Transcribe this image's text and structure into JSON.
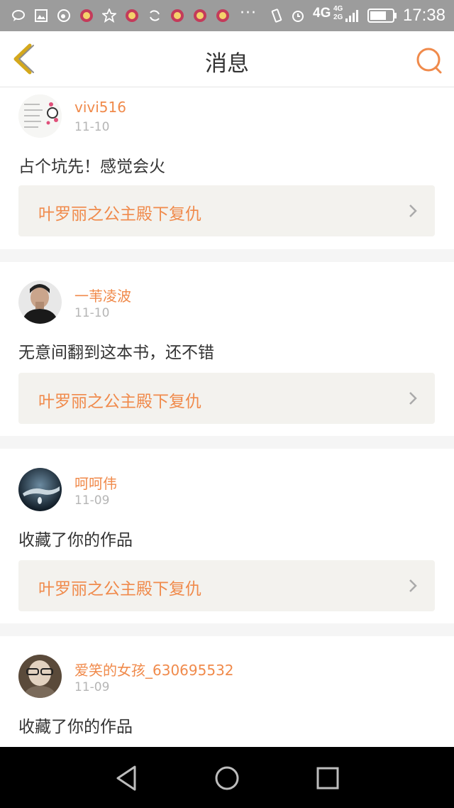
{
  "status_bar": {
    "network": "4G",
    "network_sub": [
      "4G",
      "2G"
    ],
    "time": "17:38",
    "more": "···"
  },
  "header": {
    "title": "消息",
    "back_icon": "back-chevron-icon",
    "search_icon": "search-icon"
  },
  "messages": [
    {
      "username": "vivi516",
      "date": "11-10",
      "text": "占个坑先！感觉会火",
      "book_title": "叶罗丽之公主殿下复仇"
    },
    {
      "username": "一苇凌波",
      "date": "11-10",
      "text": "无意间翻到这本书，还不错",
      "book_title": "叶罗丽之公主殿下复仇"
    },
    {
      "username": "呵呵伟",
      "date": "11-09",
      "text": "收藏了你的作品",
      "book_title": "叶罗丽之公主殿下复仇"
    },
    {
      "username": "爱笑的女孩_630695532",
      "date": "11-09",
      "text": "收藏了你的作品"
    }
  ],
  "colors": {
    "accent": "#f08a4b",
    "back_icon": "#d4a81c",
    "date": "#b5b5b5",
    "card_link_bg": "#f3f2ee"
  },
  "nav_bar": {
    "icons": [
      "back-triangle-icon",
      "home-circle-icon",
      "recents-square-icon"
    ]
  }
}
